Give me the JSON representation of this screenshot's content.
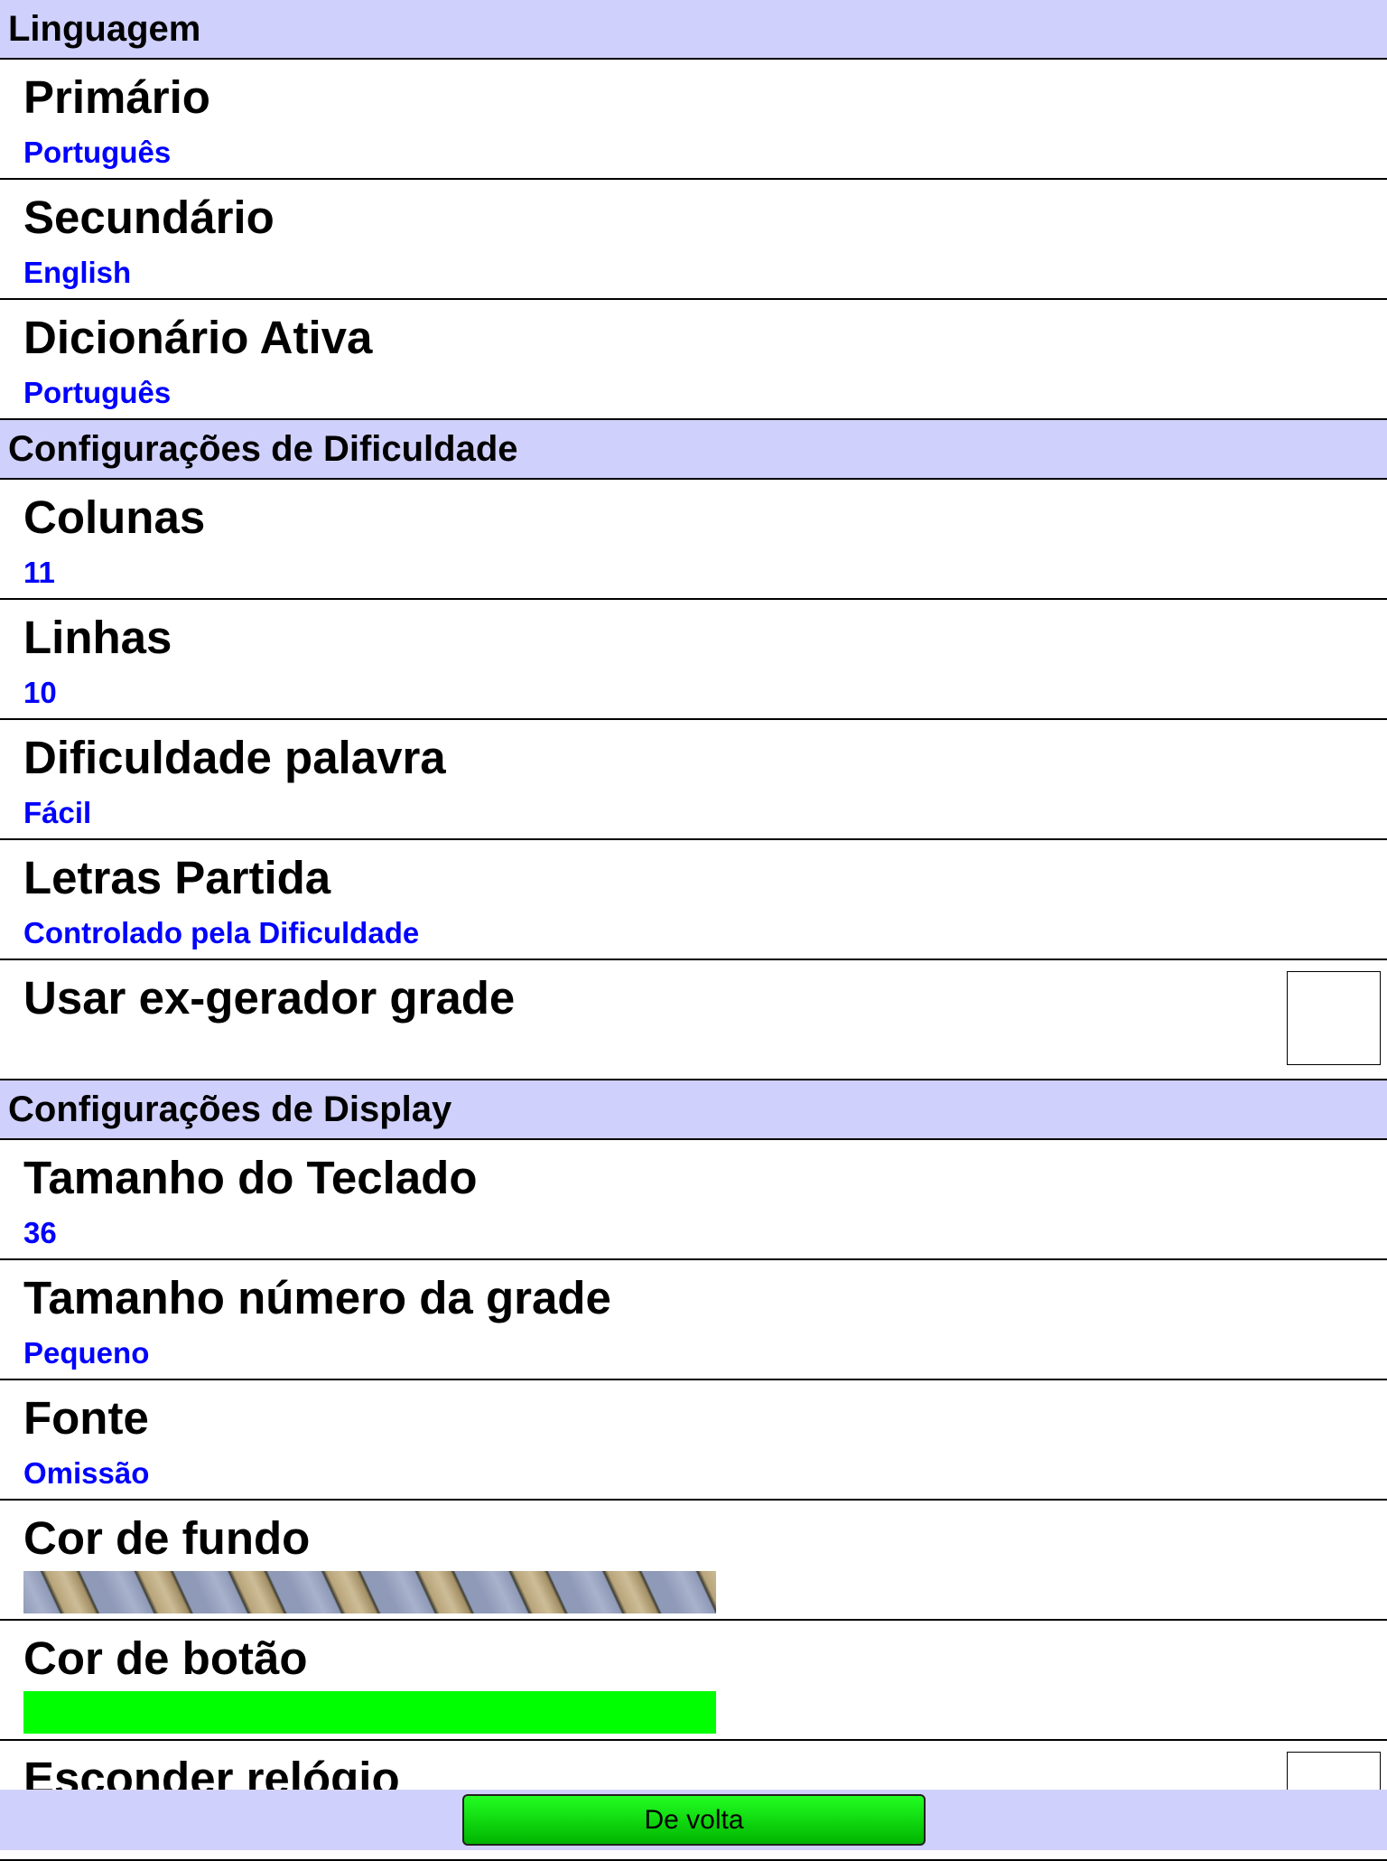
{
  "sections": [
    {
      "header": "Linguagem",
      "items": [
        {
          "title": "Primário",
          "value": "Português"
        },
        {
          "title": "Secundário",
          "value": "English"
        },
        {
          "title": "Dicionário Ativa",
          "value": "Português"
        }
      ]
    },
    {
      "header": "Configurações de Dificuldade",
      "items": [
        {
          "title": "Colunas",
          "value": "11"
        },
        {
          "title": "Linhas",
          "value": "10"
        },
        {
          "title": "Dificuldade palavra",
          "value": "Fácil"
        },
        {
          "title": "Letras Partida",
          "value": "Controlado pela Dificuldade"
        },
        {
          "title": "Usar ex-gerador grade",
          "checked": false
        }
      ]
    },
    {
      "header": "Configurações de Display",
      "items": [
        {
          "title": "Tamanho do Teclado",
          "value": "36"
        },
        {
          "title": "Tamanho número da grade",
          "value": "Pequeno"
        },
        {
          "title": "Fonte",
          "value": "Omissão"
        },
        {
          "title": "Cor de fundo",
          "swatch": "pattern-wood-stripes"
        },
        {
          "title": "Cor de botão",
          "swatch": "#00ff00"
        },
        {
          "title": "Esconder relógio",
          "checked": false
        }
      ]
    }
  ],
  "footer": {
    "back_label": "De volta",
    "button_color": "#00ff00"
  },
  "colors": {
    "section_bg": "#d0d0fc",
    "value_text": "#0000ff"
  }
}
